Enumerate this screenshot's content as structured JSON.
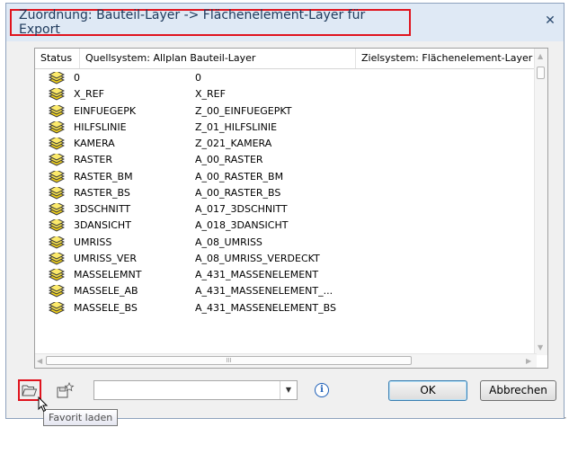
{
  "dialog": {
    "title": "Zuordnung: Bauteil-Layer -> Flächenelement-Layer für Export",
    "close_glyph": "✕"
  },
  "table": {
    "columns": [
      "Status",
      "Quellsystem: Allplan Bauteil-Layer",
      "Zielsystem: Flächenelement-Layer"
    ],
    "status_icon": "layer-stack-icon",
    "rows": [
      {
        "src": "0",
        "dst": "0"
      },
      {
        "src": "X_REF",
        "dst": "X_REF"
      },
      {
        "src": "EINFUEGEPK",
        "dst": "Z_00_EINFUEGEPKT"
      },
      {
        "src": "HILFSLINIE",
        "dst": "Z_01_HILFSLINIE"
      },
      {
        "src": "KAMERA",
        "dst": "Z_021_KAMERA"
      },
      {
        "src": "RASTER",
        "dst": "A_00_RASTER"
      },
      {
        "src": "RASTER_BM",
        "dst": "A_00_RASTER_BM"
      },
      {
        "src": "RASTER_BS",
        "dst": "A_00_RASTER_BS"
      },
      {
        "src": "3DSCHNITT",
        "dst": "A_017_3DSCHNITT"
      },
      {
        "src": "3DANSICHT",
        "dst": "A_018_3DANSICHT"
      },
      {
        "src": "UMRISS",
        "dst": "A_08_UMRISS"
      },
      {
        "src": "UMRISS_VER",
        "dst": "A_08_UMRISS_VERDECKT"
      },
      {
        "src": "MASSELEMNT",
        "dst": "A_431_MASSENELEMENT"
      },
      {
        "src": "MASSELE_AB",
        "dst": "A_431_MASSENELEMENT_..."
      },
      {
        "src": "MASSELE_BS",
        "dst": "A_431_MASSENELEMENT_BS"
      }
    ],
    "hscroll_thumb_glyph": "III"
  },
  "footer": {
    "favorite_combo_value": "",
    "info_glyph": "i",
    "ok_label": "OK",
    "cancel_label": "Abbrechen",
    "tooltip": "Favorit laden"
  },
  "colors": {
    "highlight": "#e0141e",
    "title_text": "#1e395b",
    "icon_yellow": "#f2d21b",
    "icon_dark": "#3a3a3a"
  }
}
